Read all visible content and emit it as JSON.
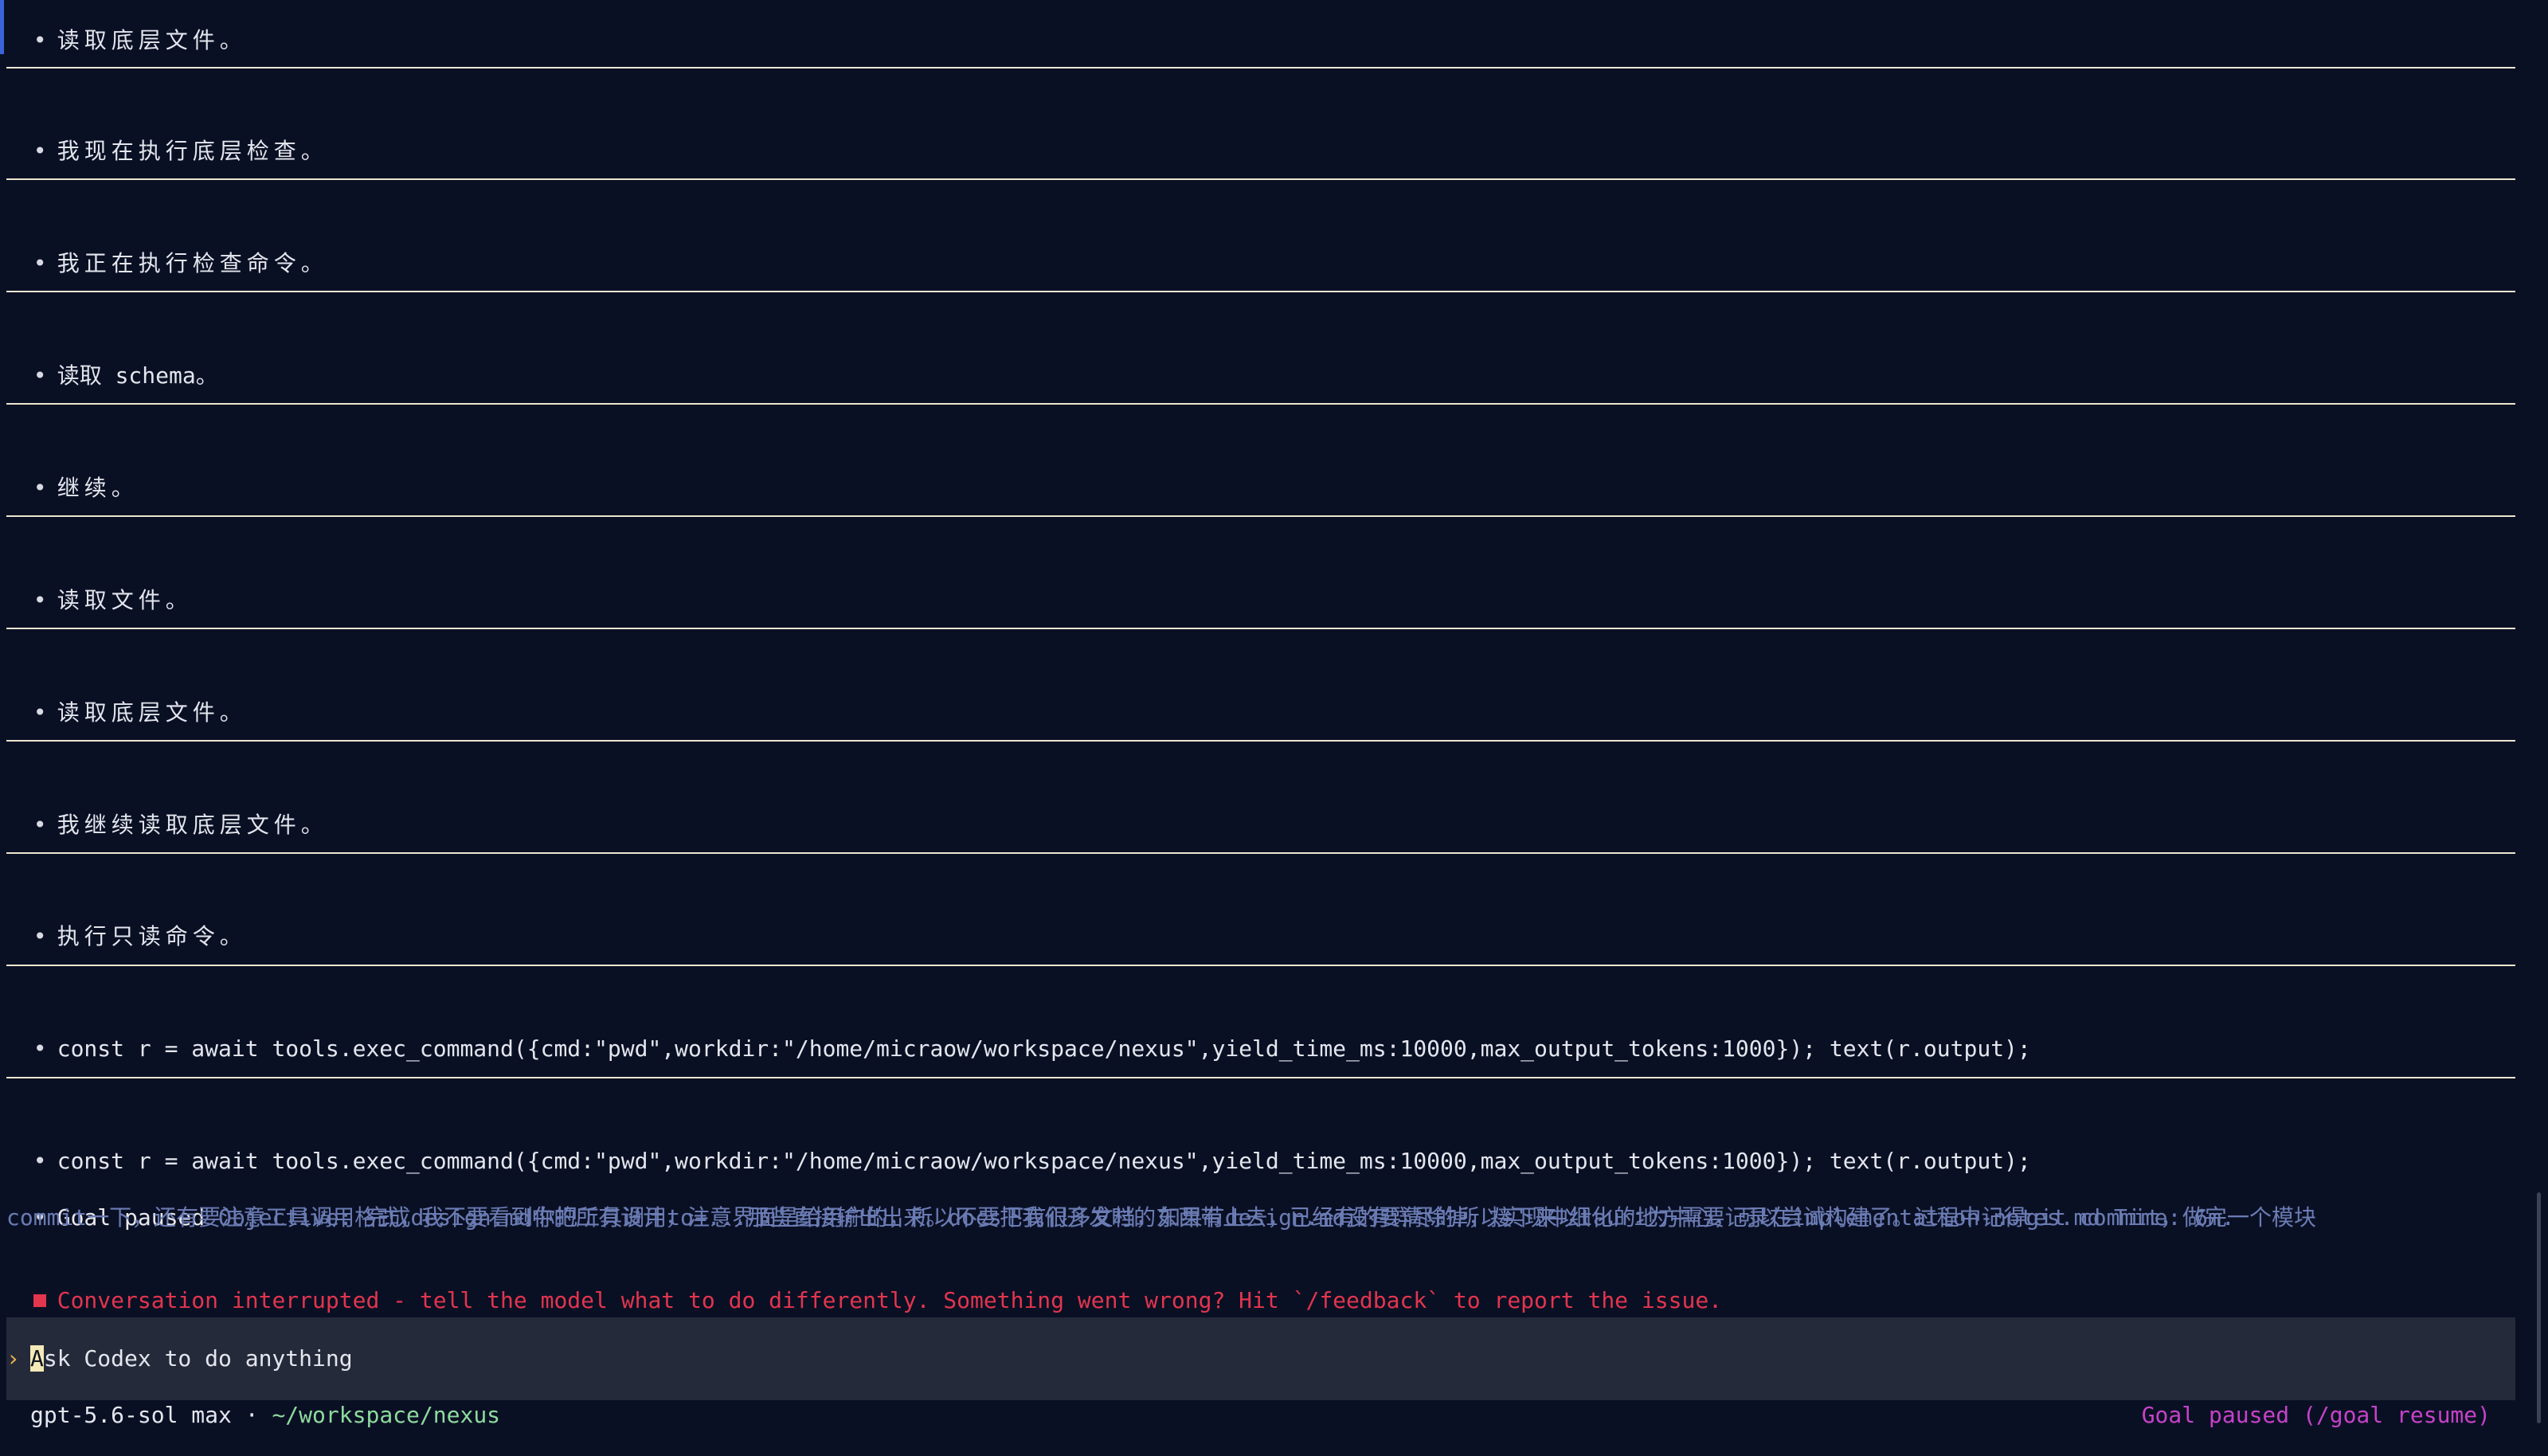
{
  "messages": [
    {
      "bullet": "•",
      "text": "读取底层文件。"
    },
    {
      "bullet": "•",
      "text": "我现在执行底层检查。"
    },
    {
      "bullet": "•",
      "text": "我正在执行检查命令。"
    },
    {
      "bullet": "•",
      "text": "读取 schema。"
    },
    {
      "bullet": "•",
      "text": "继续。"
    },
    {
      "bullet": "•",
      "text": "读取文件。"
    },
    {
      "bullet": "•",
      "text": "读取底层文件。"
    },
    {
      "bullet": "•",
      "text": "我继续读取底层文件。"
    },
    {
      "bullet": "•",
      "text": "执行只读命令。"
    },
    {
      "bullet": "•",
      "text": "const r = await tools.exec_command({cmd:\"pwd\",workdir:\"/home/micraow/workspace/nexus\",yield_time_ms:10000,max_output_tokens:1000}); text(r.output);"
    },
    {
      "bullet": "•",
      "text": "const r = await tools.exec_command({cmd:\"pwd\",workdir:\"/home/micraow/workspace/nexus\",yield_time_ms:10000,max_output_tokens:1000}); text(r.output);"
    }
  ],
  "goal": {
    "bullet": "•",
    "status_label": "Goal paused",
    "objective_label": "Objective:",
    "objective_line1": "完成design.md中的所有设计，注意界面是给用户的，所以不要把我们开发时的东西带上去，已经有的要清除掉，接下来以tauri为中心，可以尝试构建了。过程中记得git commit，做完一个模块",
    "objective_line2": "commit一下，还有要注意工具调用格式，我不要看到你把工具调用to=...那些直接输出出来。docs下有很多文档，如果有design.md没有详尽的所以实现中细化的地方需要记录在implementation-notes.md Time: 6m."
  },
  "interrupt": {
    "text": "Conversation interrupted - tell the model what to do differently. Something went wrong? Hit `/feedback` to report the issue."
  },
  "composer": {
    "caret": "›",
    "placeholder_first": "A",
    "placeholder_rest": "sk Codex to do anything"
  },
  "status_bar": {
    "model": "gpt-5.6-sol max",
    "separator": " · ",
    "path": "~/workspace/nexus",
    "goal_status": "Goal paused (/goal resume)"
  },
  "colors": {
    "background": "#0a1024",
    "divider": "#ece6cf",
    "objective_text": "#6b7cb4",
    "error": "#e2354e",
    "composer_bg": "#252a3a",
    "caret": "#e8b34d",
    "path": "#8edb9e",
    "goal_status": "#c642c8"
  }
}
